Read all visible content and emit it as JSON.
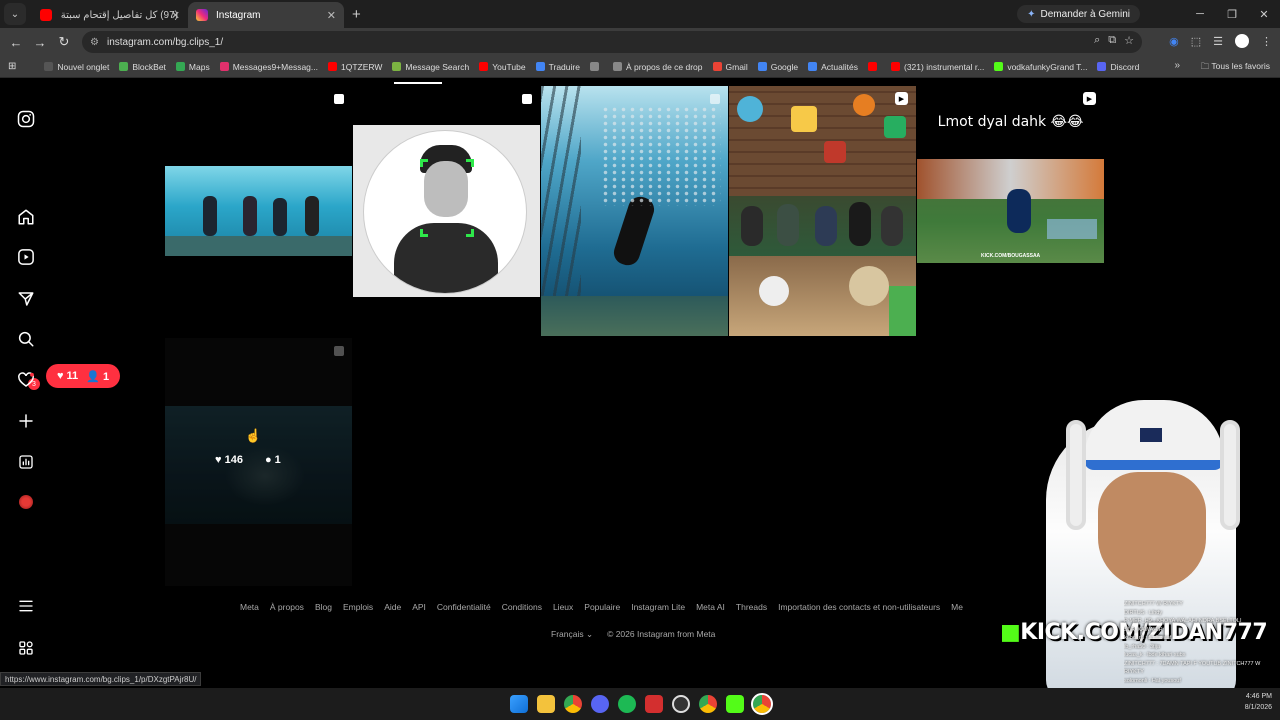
{
  "browser": {
    "tabs": [
      {
        "title": "(97) كل تفاصيل إقتحام سبتة ! إس...",
        "favicon_color": "#ff0000"
      },
      {
        "title": "Instagram",
        "favicon_color": "#e1306c"
      }
    ],
    "gemini_label": "Demander à Gemini",
    "url": "instagram.com/bg.clips_1/",
    "bookmarks": [
      {
        "label": "Nouvel onglet",
        "color": "#555"
      },
      {
        "label": "BlockBet",
        "color": "#4caf50"
      },
      {
        "label": "Maps",
        "color": "#34a853"
      },
      {
        "label": "Messages9+Messag...",
        "color": "#e1306c"
      },
      {
        "label": "1QTZERW",
        "color": "#ff0000"
      },
      {
        "label": "Message Search",
        "color": "#7cb342"
      },
      {
        "label": "YouTube",
        "color": "#ff0000"
      },
      {
        "label": "Traduire",
        "color": "#4285f4"
      },
      {
        "label": "",
        "color": "#888"
      },
      {
        "label": "À propos de ce drop",
        "color": "#888"
      },
      {
        "label": "Gmail",
        "color": "#ea4335"
      },
      {
        "label": "Google",
        "color": "#4285f4"
      },
      {
        "label": "Actualités",
        "color": "#4285f4"
      },
      {
        "label": "",
        "color": "#ff0000"
      },
      {
        "label": "(321) instrumental r...",
        "color": "#ff0000"
      },
      {
        "label": "vodkafunkyGrand T...",
        "color": "#53fc18"
      },
      {
        "label": "Discord",
        "color": "#5865f2"
      }
    ],
    "bookmarks_all": "Tous les favoris",
    "status_url": "https://www.instagram.com/bg.clips_1/p/DXzgtPAjr8U/"
  },
  "instagram": {
    "notifications": {
      "likes": "11",
      "follows": "1"
    },
    "messages_badge": "3",
    "posts": [
      {
        "kind": "carousel"
      },
      {
        "kind": "carousel"
      },
      {
        "kind": "carousel"
      },
      {
        "kind": "reel"
      },
      {
        "kind": "reel",
        "caption": "Lmot dyal dahk 😂😂",
        "watermark": "KICK.COM/BOUGASSAA"
      }
    ],
    "hover_post": {
      "likes": "146",
      "comments": "1"
    },
    "footer_links": [
      "Meta",
      "À propos",
      "Blog",
      "Emplois",
      "Aide",
      "API",
      "Confidentialité",
      "Conditions",
      "Lieux",
      "Populaire",
      "Instagram Lite",
      "Meta AI",
      "Threads",
      "Importation des contacts et non-utilisateurs",
      "Me"
    ],
    "language": "Français",
    "copyright": "© 2026 Instagram from Meta"
  },
  "stream": {
    "kick_prefix": "KICK.COM/",
    "kick_user": "ZIDAN777",
    "chat_lines": [
      "ZINITCH777 W RIYKTY",
      "DIRTUS : Lihdy",
      "P-MER_H9 : KHOYA WALAHI NDRA BSELTOLI SLA_KAWAHIR",
      "kubo_rh : fin lli saaf",
      "ib_rha50 : 3tija",
      "lucas_k : lbde kihari subs",
      "ZINITCH777 : 7DAMN TAPI F YOUTUB ZINITCH777 W RIYKTY",
      "solomonli : Hal yousouf"
    ],
    "time": "4:46 PM",
    "date": "8/1/2026"
  }
}
